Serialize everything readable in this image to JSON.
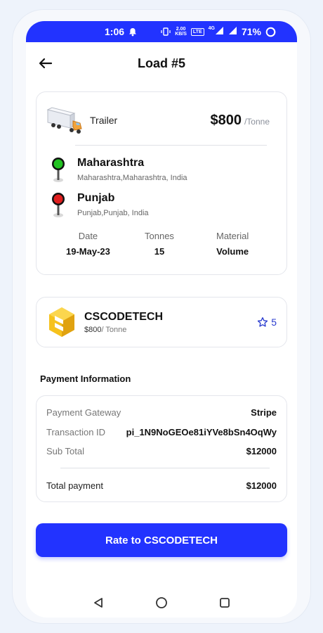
{
  "status_bar": {
    "time": "1:06",
    "net_speed_value": "2.00",
    "net_speed_unit": "KB/S",
    "volte_label": "LTE",
    "network_type": "4G",
    "battery": "71%"
  },
  "header": {
    "title": "Load #5"
  },
  "load": {
    "truck_type": "Trailer",
    "price": "$800",
    "price_unit": "/Tonne",
    "origin": {
      "name": "Maharashtra",
      "address": "Maharashtra,Maharashtra, India"
    },
    "destination": {
      "name": "Punjab",
      "address": "Punjab,Punjab, India"
    },
    "stats": {
      "date_label": "Date",
      "date_value": "19-May-23",
      "tonnes_label": "Tonnes",
      "tonnes_value": "15",
      "material_label": "Material",
      "material_value": "Volume"
    }
  },
  "company": {
    "name": "CSCODETECH",
    "price": "$800",
    "price_unit": "/ Tonne",
    "rating": "5"
  },
  "payment": {
    "section_title": "Payment Information",
    "rows": [
      {
        "label": "Payment Gateway",
        "value": "Stripe"
      },
      {
        "label": "Transaction ID",
        "value": "pi_1N9NoGEOe81iYVe8bSn4OqWy"
      },
      {
        "label": "Sub Total",
        "value": "$12000"
      }
    ],
    "total_label": "Total payment",
    "total_value": "$12000"
  },
  "cta": {
    "label": "Rate to CSCODETECH"
  },
  "colors": {
    "accent": "#2233ff",
    "origin_pin": "#22c322",
    "destination_pin": "#e01f1f",
    "rating_star": "#2a3ccf"
  },
  "icons": {
    "back": "arrow-left-icon",
    "truck": "truck-icon",
    "origin_pin": "pin-green-icon",
    "destination_pin": "pin-red-icon",
    "company_logo": "company-logo-icon",
    "star": "star-outline-icon",
    "nav_back": "triangle-back-icon",
    "nav_home": "circle-home-icon",
    "nav_recents": "square-recents-icon"
  }
}
